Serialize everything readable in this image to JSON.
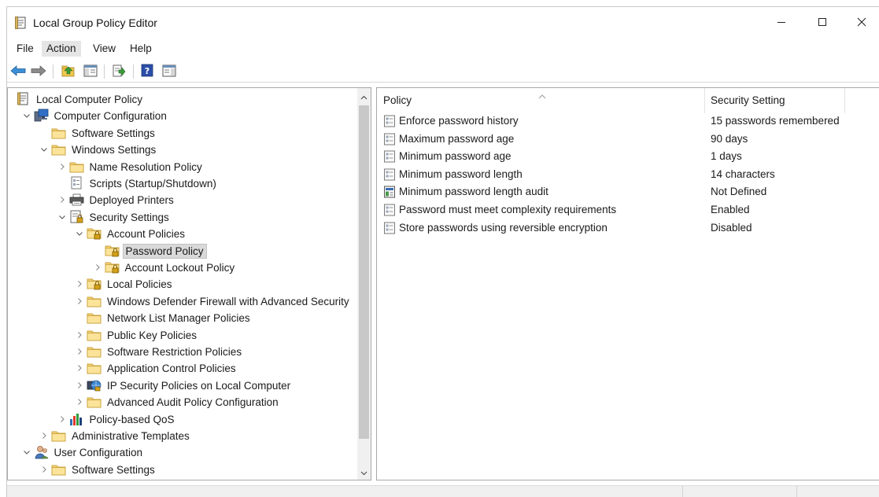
{
  "window": {
    "title": "Local Group Policy Editor",
    "controls": {
      "minimize": "minimize-icon",
      "maximize": "maximize-icon",
      "close": "close-icon"
    }
  },
  "menu": [
    {
      "label": "File",
      "active": false
    },
    {
      "label": "Action",
      "active": true
    },
    {
      "label": "View",
      "active": false
    },
    {
      "label": "Help",
      "active": false
    }
  ],
  "toolbar": [
    "back-icon",
    "forward-icon",
    "up-folder-icon",
    "show-hide-tree-icon",
    "export-list-icon",
    "help-icon",
    "show-hide-action-pane-icon"
  ],
  "tree": [
    {
      "label": "Local Computer Policy",
      "icon": "policy-doc-icon",
      "chevron": "none"
    },
    {
      "label": "Computer Configuration",
      "icon": "computer-icon",
      "chevron": "down"
    },
    {
      "label": "Software Settings",
      "icon": "folder-icon",
      "chevron": "none"
    },
    {
      "label": "Windows Settings",
      "icon": "folder-icon",
      "chevron": "down"
    },
    {
      "label": "Name Resolution Policy",
      "icon": "folder-icon",
      "chevron": "right"
    },
    {
      "label": "Scripts (Startup/Shutdown)",
      "icon": "script-icon",
      "chevron": "none"
    },
    {
      "label": "Deployed Printers",
      "icon": "printer-icon",
      "chevron": "right"
    },
    {
      "label": "Security Settings",
      "icon": "security-settings-icon",
      "chevron": "down"
    },
    {
      "label": "Account Policies",
      "icon": "locked-folder-icon",
      "chevron": "down"
    },
    {
      "label": "Password Policy",
      "icon": "locked-folder-icon",
      "chevron": "none",
      "selected": true
    },
    {
      "label": "Account Lockout Policy",
      "icon": "locked-folder-icon",
      "chevron": "right"
    },
    {
      "label": "Local Policies",
      "icon": "locked-folder-icon",
      "chevron": "right"
    },
    {
      "label": "Windows Defender Firewall with Advanced Security",
      "icon": "folder-icon",
      "chevron": "right"
    },
    {
      "label": "Network List Manager Policies",
      "icon": "folder-icon",
      "chevron": "none"
    },
    {
      "label": "Public Key Policies",
      "icon": "folder-icon",
      "chevron": "right"
    },
    {
      "label": "Software Restriction Policies",
      "icon": "folder-icon",
      "chevron": "right"
    },
    {
      "label": "Application Control Policies",
      "icon": "folder-icon",
      "chevron": "right"
    },
    {
      "label": "IP Security Policies on Local Computer",
      "icon": "ip-security-icon",
      "chevron": "right"
    },
    {
      "label": "Advanced Audit Policy Configuration",
      "icon": "folder-icon",
      "chevron": "right"
    },
    {
      "label": "Policy-based QoS",
      "icon": "qos-chart-icon",
      "chevron": "right"
    },
    {
      "label": "Administrative Templates",
      "icon": "folder-icon",
      "chevron": "right"
    },
    {
      "label": "User Configuration",
      "icon": "user-icon",
      "chevron": "down"
    },
    {
      "label": "Software Settings",
      "icon": "folder-icon",
      "chevron": "right"
    }
  ],
  "list": {
    "columns": {
      "policy": "Policy",
      "setting": "Security Setting"
    },
    "rows": [
      {
        "policy": "Enforce password history",
        "setting": "15 passwords remembered",
        "icon": "policy-setting-icon"
      },
      {
        "policy": "Maximum password age",
        "setting": "90 days",
        "icon": "policy-setting-icon"
      },
      {
        "policy": "Minimum password age",
        "setting": "1 days",
        "icon": "policy-setting-icon"
      },
      {
        "policy": "Minimum password length",
        "setting": "14 characters",
        "icon": "policy-setting-icon"
      },
      {
        "policy": "Minimum password length audit",
        "setting": "Not Defined",
        "icon": "audit-setting-icon"
      },
      {
        "policy": "Password must meet complexity requirements",
        "setting": "Enabled",
        "icon": "policy-setting-icon"
      },
      {
        "policy": "Store passwords using reversible encryption",
        "setting": "Disabled",
        "icon": "policy-setting-icon"
      }
    ]
  }
}
